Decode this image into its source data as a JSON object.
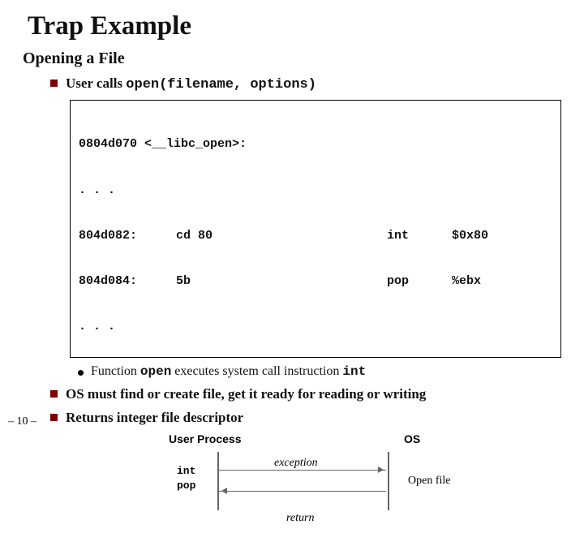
{
  "title": "Trap Example",
  "subtitle": "Opening a File",
  "bullets": {
    "b0_prefix": "User calls ",
    "b0_code": "open(filename, options)",
    "b1": "OS must find or create file, get it ready for reading or writing",
    "b2": "Returns integer file descriptor"
  },
  "code": {
    "l0": "0804d070 <__libc_open>:",
    "l1": ". . .",
    "r2_addr": "804d082:",
    "r2_hex": "cd 80",
    "r2_mn": "int",
    "r2_arg": "$0x80",
    "r3_addr": "804d084:",
    "r3_hex": "5b",
    "r3_mn": "pop",
    "r3_arg": "%ebx",
    "l4": ". . ."
  },
  "subbullet": {
    "prefix": "Function ",
    "open": "open",
    "mid": " executes system call instruction ",
    "int": "int"
  },
  "diagram": {
    "user": "User Process",
    "os": "OS",
    "int": "int",
    "pop": "pop",
    "exception": "exception",
    "openfile": "Open file",
    "return": "return"
  },
  "slidenum": "– 10 –"
}
